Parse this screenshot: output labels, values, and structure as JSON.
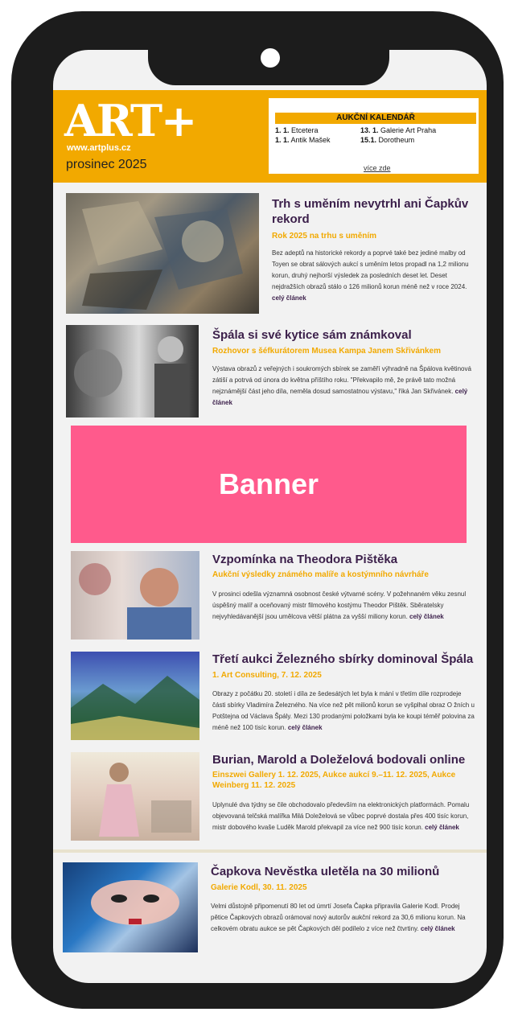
{
  "header": {
    "logo": "ART+",
    "site": "www.artplus.cz",
    "month": "prosinec 2025"
  },
  "calendar": {
    "title": "AUKČNÍ KALENDÁŘ",
    "items": [
      {
        "date": "1. 1.",
        "name": "Etcetera"
      },
      {
        "date": "1. 1.",
        "name": "Antik Mašek"
      },
      {
        "date": "13. 1.",
        "name": "Galerie Art Praha"
      },
      {
        "date": "15.1.",
        "name": "Dorotheum"
      }
    ],
    "more": "více zde"
  },
  "banner": {
    "label": "Banner"
  },
  "articles": [
    {
      "title": "Trh s uměním nevytrhl ani Čapkův rekord",
      "subtitle": "Rok 2025 na trhu s uměním",
      "body": "Bez adeptů na historické rekordy a poprvé také bez jediné malby od Toyen se obrat sálových aukcí s uměním letos propadl na 1,2 milionu korun, druhý nejhorší výsledek za posledních deset let. Deset nejdražších obrazů stálo o 126 milionů korun méně než v roce 2024.",
      "more": "celý článek"
    },
    {
      "title": "Špála si své kytice sám známkoval",
      "subtitle": "Rozhovor s šéfkurátorem Musea Kampa Janem Skřivánkem",
      "body": "Výstava obrazů z veřejných i soukromých sbírek se zaměří výhradně na Špálova květinová zátiší a potrvá od února do května příštího roku. \"Překvapilo mě, že právě tato možná nejznámější část jeho díla, neměla dosud samostatnou výstavu,\" říká Jan Skřivánek.",
      "more": "celý článek"
    },
    {
      "title": "Vzpomínka na Theodora Pištěka",
      "subtitle": "Aukční výsledky známého malíře a kostýmního návrháře",
      "body": "V prosinci odešla významná osobnost české výtvarné scény. V požehnaném věku zesnul úspěšný malíř a oceňovaný mistr filmového kostýmu Theodor Pištěk. Sběratelsky nejvyhledávanější jsou umělcova větší plátna za vyšší miliony korun.",
      "more": "celý článek"
    },
    {
      "title": "Třetí aukci Železného sbírky dominoval Špála",
      "subtitle": "1. Art Consulting, 7. 12. 2025",
      "body": "Obrazy z počátku 20. století i díla ze šedesátých let byla k mání v třetím díle rozprodeje části sbírky Vladimíra Železného. Na více než pět milionů korun se vyšplhal obraz O žních u Potštejna od Václava Špály. Mezi 130 prodanými položkami byla ke koupi téměř polovina za méně než 100 tisíc korun.",
      "more": "celý článek"
    },
    {
      "title": "Burian, Marold a Doleželová bodovali online",
      "subtitle": "Einszwei Gallery 1. 12. 2025, Aukce aukcí 9.–11. 12. 2025, Aukce Weinberg 11. 12. 2025",
      "body": "Uplynulé dva týdny se čile obchodovalo především na elektronických platformách. Pomalu objevovaná telčská malířka Milá Doleželová se vůbec poprvé dostala přes 400 tisíc korun, mistr dobového kvaše Luděk Marold překvapil za více než 900 tisíc korun.",
      "more": "celý článek"
    },
    {
      "title": "Čapkova Nevěstka uletěla na 30 milionů",
      "subtitle": "Galerie Kodl, 30. 11. 2025",
      "body": "Velmi důstojně připomenutí 80 let od úmrtí Josefa Čapka připravila Galerie Kodl. Prodej pětice Čapkových obrazů orámoval nový autorův aukční rekord za 30,6 milionu korun. Na celkovém obratu aukce se pět Čapkových děl podílelo z více než čtvrtiny.",
      "more": "celý článek"
    }
  ],
  "colors": {
    "accent": "#f2a900",
    "title": "#3b1f4a",
    "banner": "#ff5a8c",
    "frame": "#1c1c1c"
  }
}
